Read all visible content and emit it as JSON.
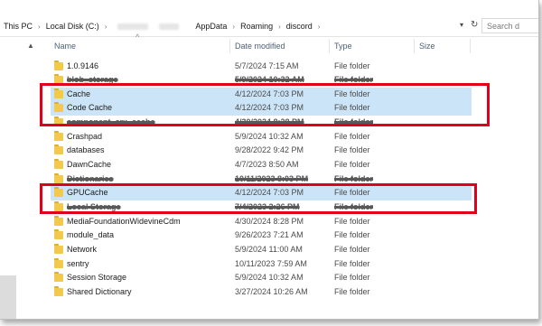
{
  "address_bar": {
    "crumbs": [
      "This PC",
      "Local Disk (C:)",
      "AppData",
      "Roaming",
      "discord"
    ],
    "search_placeholder": "Search d"
  },
  "icons": {
    "separator": "chevron-right-icon",
    "dropdown": "chevron-down-icon",
    "refresh": "refresh-icon",
    "folder": "folder-icon",
    "scroll_up": "chevron-up-icon",
    "sort": "sort-ascending-icon"
  },
  "columns": {
    "name": "Name",
    "date": "Date modified",
    "type": "Type",
    "size": "Size"
  },
  "colors": {
    "selection": "#cce4f7",
    "highlight": "#e1001a",
    "folder": "#f2c94c"
  },
  "files": [
    {
      "name": "1.0.9146",
      "date": "5/7/2024 7:15 AM",
      "type": "File folder",
      "selected": false,
      "redacted": false
    },
    {
      "name": "blob_storage",
      "date": "5/9/2024 10:32 AM",
      "type": "File folder",
      "selected": false,
      "redacted": true
    },
    {
      "name": "Cache",
      "date": "4/12/2024 7:03 PM",
      "type": "File folder",
      "selected": true,
      "redacted": false
    },
    {
      "name": "Code Cache",
      "date": "4/12/2024 7:03 PM",
      "type": "File folder",
      "selected": true,
      "redacted": false
    },
    {
      "name": "component_crx_cache",
      "date": "4/30/2024 8:28 PM",
      "type": "File folder",
      "selected": false,
      "redacted": true
    },
    {
      "name": "Crashpad",
      "date": "5/9/2024 10:32 AM",
      "type": "File folder",
      "selected": false,
      "redacted": false
    },
    {
      "name": "databases",
      "date": "9/28/2022 9:42 PM",
      "type": "File folder",
      "selected": false,
      "redacted": false
    },
    {
      "name": "DawnCache",
      "date": "4/7/2023 8:50 AM",
      "type": "File folder",
      "selected": false,
      "redacted": false
    },
    {
      "name": "Dictionaries",
      "date": "10/11/2023 8:03 PM",
      "type": "File folder",
      "selected": false,
      "redacted": true
    },
    {
      "name": "GPUCache",
      "date": "4/12/2024 7:03 PM",
      "type": "File folder",
      "selected": true,
      "redacted": false
    },
    {
      "name": "Local Storage",
      "date": "7/4/2023 2:26 PM",
      "type": "File folder",
      "selected": false,
      "redacted": true
    },
    {
      "name": "MediaFoundationWidevineCdm",
      "date": "4/30/2024 8:28 PM",
      "type": "File folder",
      "selected": false,
      "redacted": false
    },
    {
      "name": "module_data",
      "date": "9/26/2023 7:21 AM",
      "type": "File folder",
      "selected": false,
      "redacted": false
    },
    {
      "name": "Network",
      "date": "5/9/2024 11:00 AM",
      "type": "File folder",
      "selected": false,
      "redacted": false
    },
    {
      "name": "sentry",
      "date": "10/11/2023 7:59 AM",
      "type": "File folder",
      "selected": false,
      "redacted": false
    },
    {
      "name": "Session Storage",
      "date": "5/9/2024 10:32 AM",
      "type": "File folder",
      "selected": false,
      "redacted": false
    },
    {
      "name": "Shared Dictionary",
      "date": "3/27/2024 10:26 AM",
      "type": "File folder",
      "selected": false,
      "redacted": false
    }
  ]
}
